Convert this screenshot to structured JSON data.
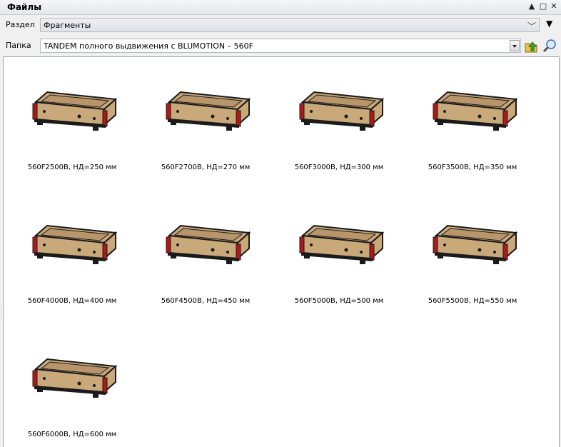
{
  "window": {
    "title": "Файлы"
  },
  "section": {
    "label": "Раздел",
    "value": "Фрагменты"
  },
  "folder": {
    "label": "Папка",
    "value": "TANDEM полного выдвижения с BLUMOTION – 560F"
  },
  "items": [
    {
      "caption": "560F2500B, НД=250 мм"
    },
    {
      "caption": "560F2700B, НД=270 мм"
    },
    {
      "caption": "560F3000B, НД=300 мм"
    },
    {
      "caption": "560F3500B, НД=350 мм"
    },
    {
      "caption": "560F4000B, НД=400 мм"
    },
    {
      "caption": "560F4500B, НД=450 мм"
    },
    {
      "caption": "560F5000B, НД=500 мм"
    },
    {
      "caption": "560F5500B, НД=550 мм"
    },
    {
      "caption": "560F6000B, НД=600 мм"
    }
  ],
  "colors": {
    "wood": "#c9a87a",
    "rail": "#b01818",
    "outline": "#1a1a1a"
  }
}
